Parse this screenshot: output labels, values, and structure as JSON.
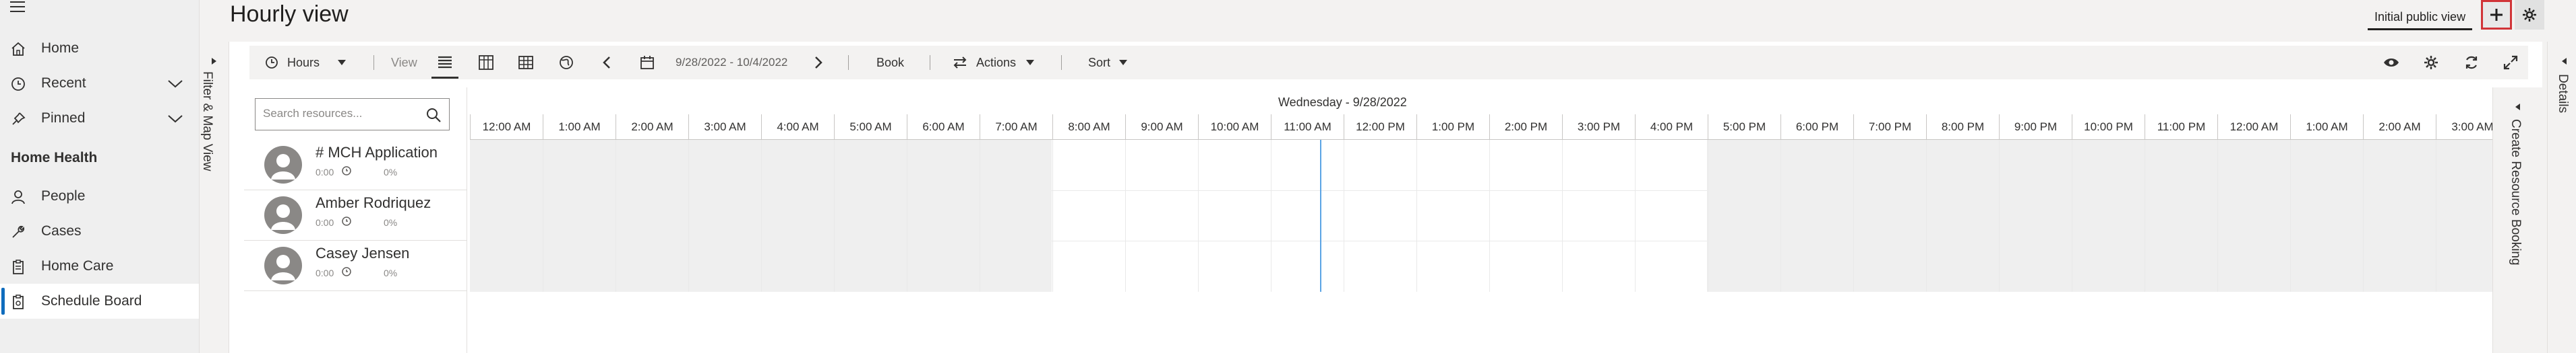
{
  "app": {
    "page_title": "Hourly view"
  },
  "header": {
    "view_tab": "Initial public view"
  },
  "sidebar": {
    "items": [
      {
        "label": "Home",
        "icon": "home-icon"
      },
      {
        "label": "Recent",
        "icon": "clock-icon"
      },
      {
        "label": "Pinned",
        "icon": "pin-icon"
      }
    ],
    "section_title": "Home Health",
    "section_items": [
      {
        "label": "People",
        "icon": "person-icon"
      },
      {
        "label": "Cases",
        "icon": "wrench-icon"
      },
      {
        "label": "Home Care",
        "icon": "clipboard-icon"
      },
      {
        "label": "Schedule Board",
        "icon": "calendar-clipboard-icon",
        "selected": true
      }
    ]
  },
  "filter_panel": {
    "label": "Filter & Map View"
  },
  "toolbar": {
    "scale_label": "Hours",
    "view_label": "View",
    "date_range": "9/28/2022 - 10/4/2022",
    "book_label": "Book",
    "actions_label": "Actions",
    "sort_label": "Sort"
  },
  "resources": {
    "search_placeholder": "Search resources...",
    "rows": [
      {
        "name": "# MCH Application",
        "hours": "0:00",
        "percent": "0%"
      },
      {
        "name": "Amber Rodriquez",
        "hours": "0:00",
        "percent": "0%"
      },
      {
        "name": "Casey Jensen",
        "hours": "0:00",
        "percent": "0%"
      }
    ]
  },
  "timeline": {
    "date_label": "Wednesday - 9/28/2022",
    "hours": [
      "12:00 AM",
      "1:00 AM",
      "2:00 AM",
      "3:00 AM",
      "4:00 AM",
      "5:00 AM",
      "6:00 AM",
      "7:00 AM",
      "8:00 AM",
      "9:00 AM",
      "10:00 AM",
      "11:00 AM",
      "12:00 PM",
      "1:00 PM",
      "2:00 PM",
      "3:00 PM",
      "4:00 PM",
      "5:00 PM",
      "6:00 PM",
      "7:00 PM",
      "8:00 PM",
      "9:00 PM",
      "10:00 PM",
      "11:00 PM",
      "12:00 AM",
      "1:00 AM",
      "2:00 AM",
      "3:00 AM"
    ]
  },
  "booking_panel": {
    "label": "Create Resource Booking"
  },
  "details_panel": {
    "label": "Details"
  },
  "colors": {
    "accent": "#0f6cbd",
    "now_line": "#5ba4e5",
    "highlight_border": "#d13438"
  }
}
